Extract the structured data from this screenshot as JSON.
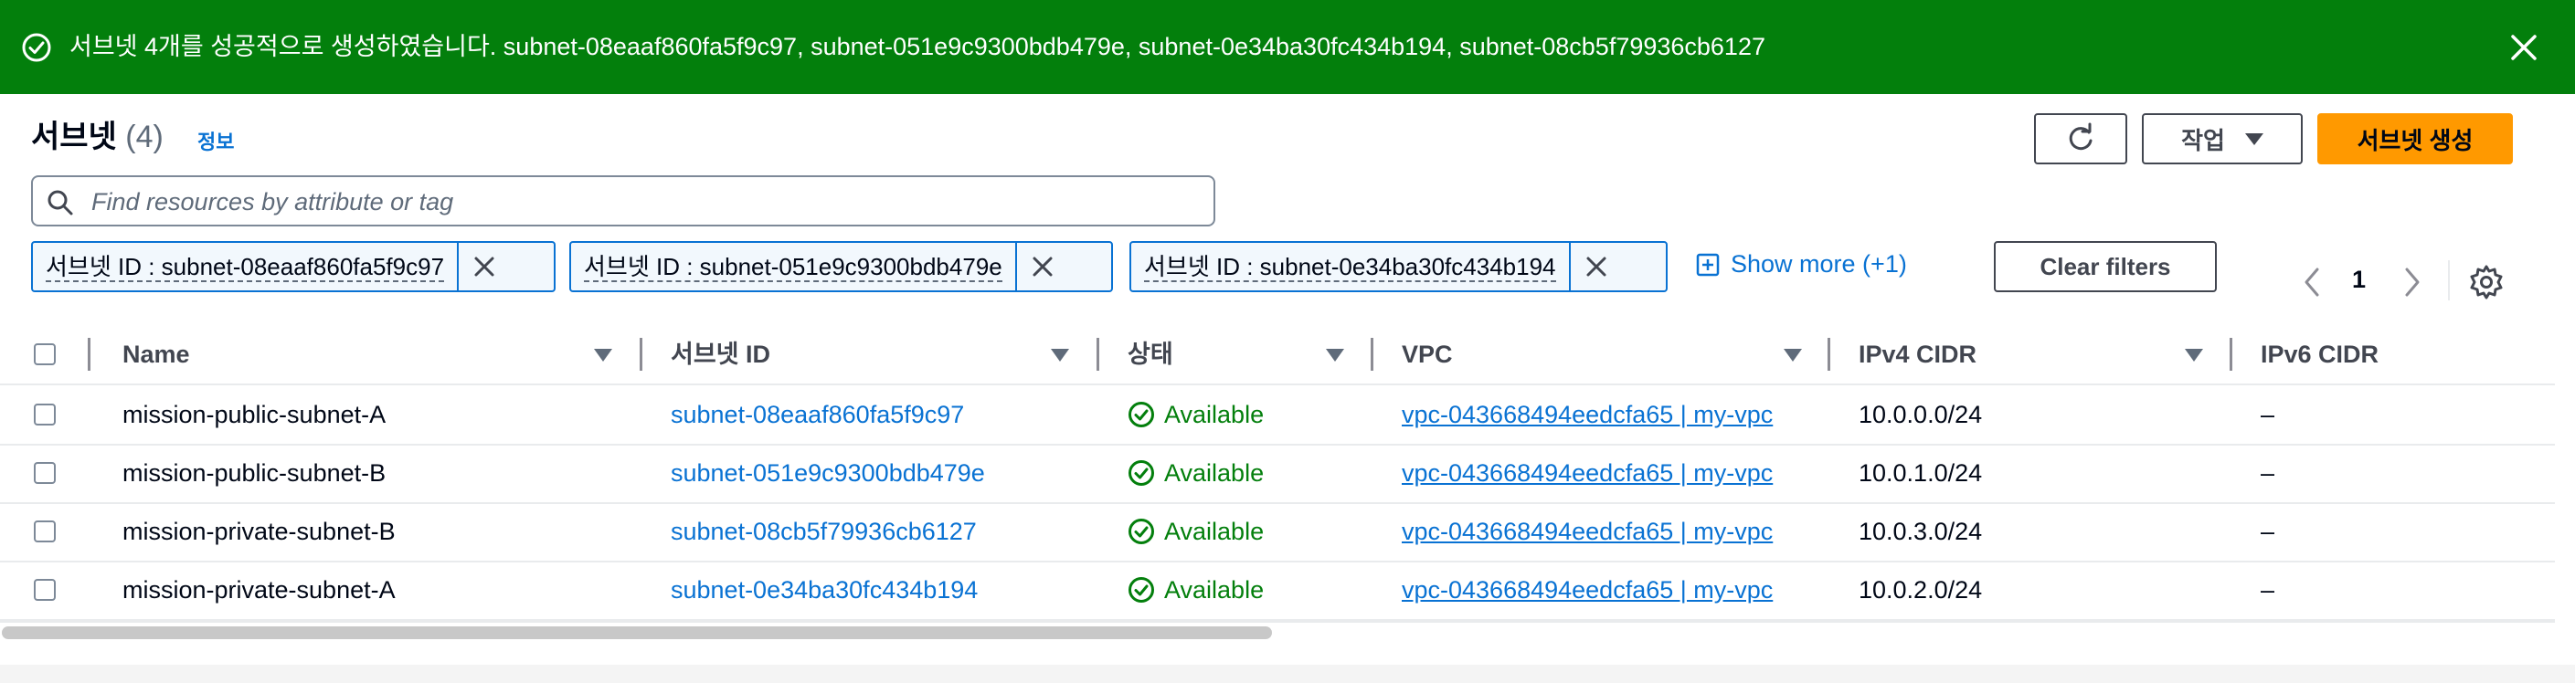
{
  "flash": {
    "message": "서브넷 4개를 성공적으로 생성하였습니다. subnet-08eaaf860fa5f9c97, subnet-051e9c9300bdb479e, subnet-0e34ba30fc434b194, subnet-08cb5f79936cb6127",
    "icon": "success-check-icon",
    "color": "#037f0c"
  },
  "header": {
    "title": "서브넷",
    "count": "(4)",
    "info_link": "정보",
    "actions_label": "작업",
    "create_label": "서브넷 생성"
  },
  "search": {
    "placeholder": "Find resources by attribute or tag",
    "value": ""
  },
  "filters": {
    "tokens": [
      {
        "label": "서브넷 ID : subnet-08eaaf860fa5f9c97"
      },
      {
        "label": "서브넷 ID : subnet-051e9c9300bdb479e"
      },
      {
        "label": "서브넷 ID : subnet-0e34ba30fc434b194"
      }
    ],
    "show_more": "Show more (+1)",
    "clear_label": "Clear filters"
  },
  "pagination": {
    "page": "1"
  },
  "table": {
    "columns": [
      "Name",
      "서브넷 ID",
      "상태",
      "VPC",
      "IPv4 CIDR",
      "IPv6 CIDR"
    ],
    "rows": [
      {
        "name": "mission-public-subnet-A",
        "subnet_id": "subnet-08eaaf860fa5f9c97",
        "state": "Available",
        "vpc": "vpc-043668494eedcfa65 | my-vpc",
        "ipv4": "10.0.0.0/24",
        "ipv6": "–"
      },
      {
        "name": "mission-public-subnet-B",
        "subnet_id": "subnet-051e9c9300bdb479e",
        "state": "Available",
        "vpc": "vpc-043668494eedcfa65 | my-vpc",
        "ipv4": "10.0.1.0/24",
        "ipv6": "–"
      },
      {
        "name": "mission-private-subnet-B",
        "subnet_id": "subnet-08cb5f79936cb6127",
        "state": "Available",
        "vpc": "vpc-043668494eedcfa65 | my-vpc",
        "ipv4": "10.0.3.0/24",
        "ipv6": "–"
      },
      {
        "name": "mission-private-subnet-A",
        "subnet_id": "subnet-0e34ba30fc434b194",
        "state": "Available",
        "vpc": "vpc-043668494eedcfa65 | my-vpc",
        "ipv4": "10.0.2.0/24",
        "ipv6": "–"
      }
    ]
  },
  "colors": {
    "accent_link": "#0972d3",
    "primary_button": "#ff9900",
    "success": "#037f0c"
  }
}
